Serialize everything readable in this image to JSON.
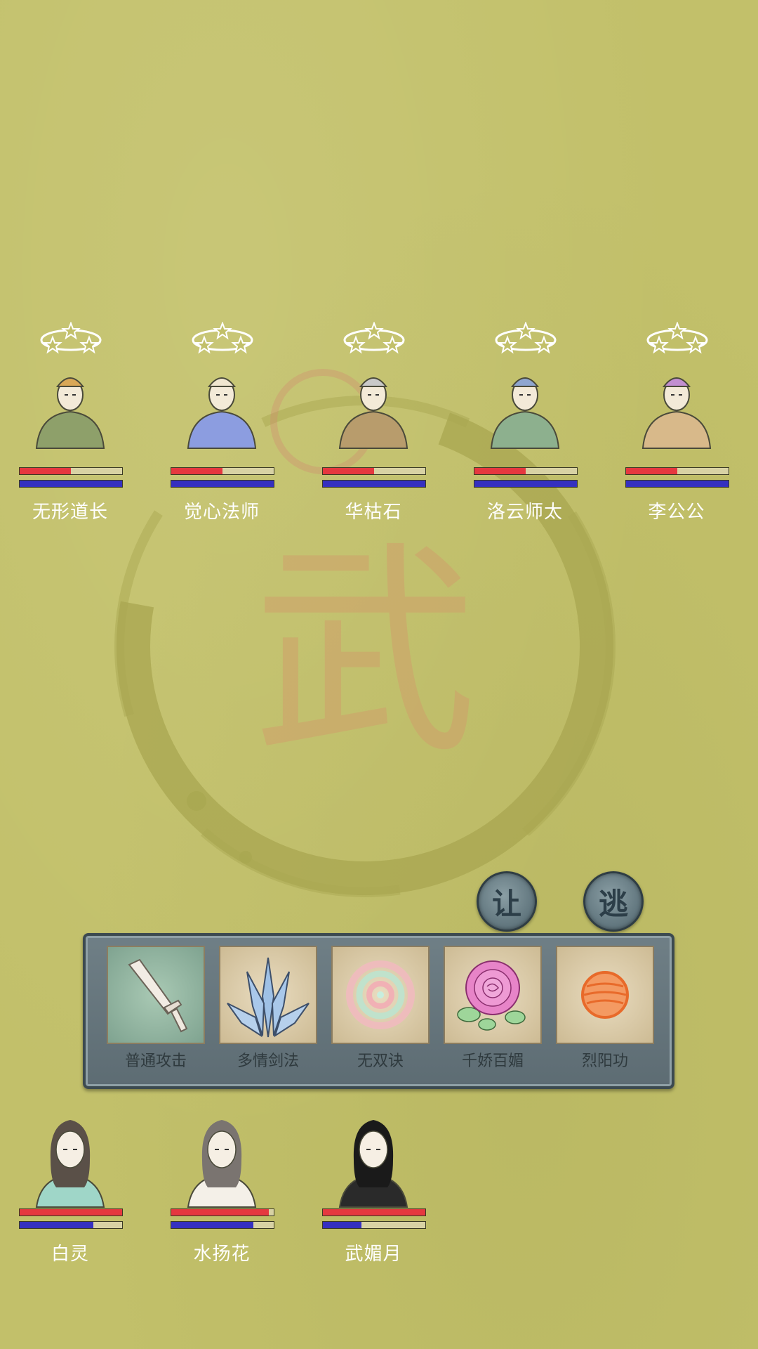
{
  "enemies": [
    {
      "name": "无形道长",
      "hp": 0.5,
      "mp": 1.0,
      "robe": "#8ea06a",
      "hat": "#d9a756"
    },
    {
      "name": "觉心法师",
      "hp": 0.5,
      "mp": 1.0,
      "robe": "#8c9de0",
      "hat": "#f0e6d0"
    },
    {
      "name": "华枯石",
      "hp": 0.5,
      "mp": 1.0,
      "robe": "#b89c6c",
      "hat": "#c9c9c9"
    },
    {
      "name": "洛云师太",
      "hp": 0.5,
      "mp": 1.0,
      "robe": "#8db08e",
      "hat": "#8fa6d0"
    },
    {
      "name": "李公公",
      "hp": 0.5,
      "mp": 1.0,
      "robe": "#d8b98a",
      "hat": "#c28fd0"
    }
  ],
  "allies": [
    {
      "name": "白灵",
      "hp": 1.0,
      "mp": 0.72,
      "robe": "#9fd6c8",
      "hair": "#5a5048"
    },
    {
      "name": "水扬花",
      "hp": 0.95,
      "mp": 0.8,
      "robe": "#f4f0e8",
      "hair": "#7a7470"
    },
    {
      "name": "武媚月",
      "hp": 1.0,
      "mp": 0.38,
      "robe": "#2a2a2a",
      "hair": "#1a1a1a"
    }
  ],
  "actions": {
    "yield_label": "让",
    "flee_label": "逃"
  },
  "skills": [
    {
      "label": "普通攻击",
      "icon": "sword-icon"
    },
    {
      "label": "多情剑法",
      "icon": "blades-fan-icon"
    },
    {
      "label": "无双诀",
      "icon": "spiral-icon"
    },
    {
      "label": "千娇百媚",
      "icon": "rose-icon"
    },
    {
      "label": "烈阳功",
      "icon": "sun-orb-icon"
    }
  ],
  "watermark_char": "武",
  "colors": {
    "background": "#c2c06a",
    "hp": "#e5383f",
    "mp": "#3530c0"
  }
}
